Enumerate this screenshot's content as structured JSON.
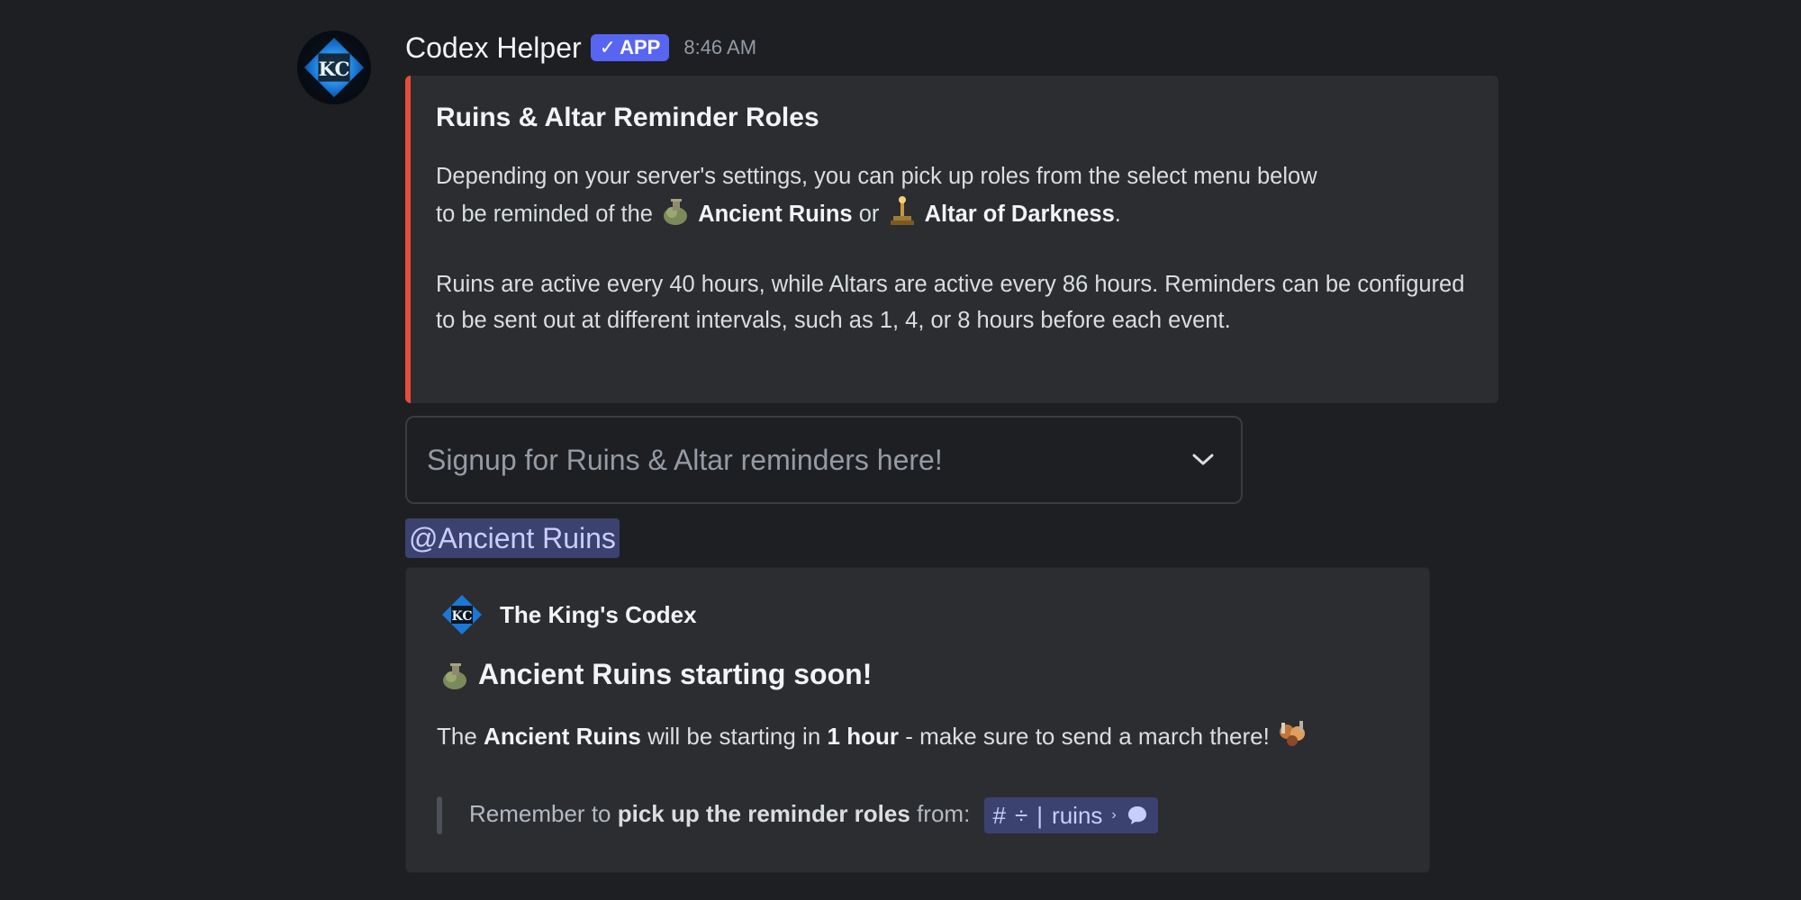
{
  "message": {
    "author": "Codex Helper",
    "badge": "APP",
    "badge_check": "✓",
    "timestamp": "8:46 AM",
    "avatar_icon": "kc-diamond-logo-icon"
  },
  "embed_reminder": {
    "accent_color": "#e74c3c",
    "title": "Ruins & Altar Reminder Roles",
    "line1_a": "Depending on your server's settings, you can pick up roles from the select menu below",
    "line1_b": "to be reminded of the",
    "ruins_name": "Ancient Ruins",
    "or": "or",
    "altar_name": "Altar of Darkness",
    "period": ".",
    "paragraph2": "Ruins are active every 40 hours, while Altars are active every 86 hours. Reminders can be configured to be sent out at different intervals, such as 1, 4, or 8 hours before each event."
  },
  "select_menu": {
    "placeholder": "Signup for Ruins & Altar reminders here!"
  },
  "role_mention": "@Ancient Ruins",
  "embed_event": {
    "author_name": "The King's Codex",
    "title": "Ancient Ruins starting soon!",
    "desc_pre": "The",
    "desc_bold1": "Ancient Ruins",
    "desc_mid": "will be starting in",
    "desc_bold2": "1 hour",
    "desc_post": "- make sure to send a march there!",
    "quote_pre": "Remember to",
    "quote_bold": "pick up the reminder roles",
    "quote_post": "from:",
    "channel_hash": "#",
    "channel_divider": "÷",
    "channel_sep": "|",
    "channel_name": "ruins",
    "channel_arrow": "›"
  },
  "colors": {
    "background": "#1e1f22",
    "embed_bg": "#2b2d31",
    "mention_bg": "#3c4270",
    "brand": "#5865f2"
  }
}
